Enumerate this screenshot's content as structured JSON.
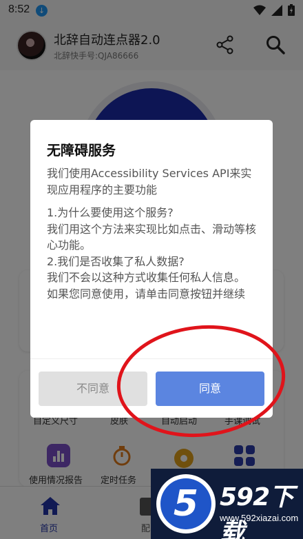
{
  "status_bar": {
    "time": "8:52"
  },
  "header": {
    "title": "北辞自动连点器2.0",
    "subtitle": "北辞快手号:QJA86666"
  },
  "feature_grid": {
    "row1": [
      "自定义尺寸",
      "皮肤",
      "自动启动",
      "手课调试"
    ],
    "row2": [
      "使用情况报告",
      "定时任务"
    ]
  },
  "bottom_nav": {
    "home": "首页",
    "config": "配"
  },
  "dialog": {
    "title": "无障碍服务",
    "paragraphs": [
      "我们使用Accessibility Services API来实现应用程序的主要功能",
      "1.为什么要使用这个服务?\n我们用这个方法来实现比如点击、滑动等核心功能。\n2.我们是否收集了私人数据?\n我们不会以这种方式收集任何私人信息。\n如果您同意使用，请单击同意按钮并继续"
    ],
    "disagree_label": "不同意",
    "agree_label": "同意"
  },
  "watermark": {
    "logo_digit": "5",
    "brand": "592下载",
    "url": "www.592xiazai.com"
  },
  "colors": {
    "primary_blue": "#1a2aa8",
    "agree_button": "#5b85e0",
    "annotation_red": "#e0141b"
  }
}
